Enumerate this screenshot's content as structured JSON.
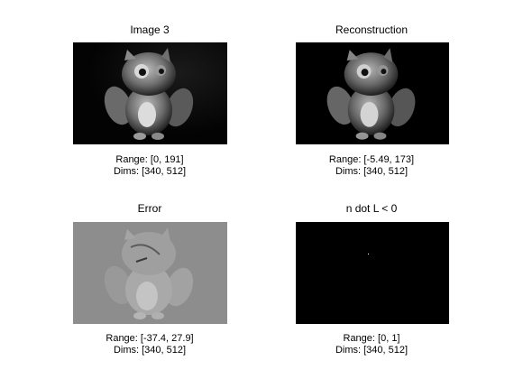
{
  "panels": [
    {
      "title": "Image 3",
      "range": "Range: [0, 191]",
      "dims": "Dims: [340, 512]"
    },
    {
      "title": "Reconstruction",
      "range": "Range: [-5.49, 173]",
      "dims": "Dims: [340, 512]"
    },
    {
      "title": "Error",
      "range": "Range: [-37.4, 27.9]",
      "dims": "Dims: [340, 512]"
    },
    {
      "title": "n dot L < 0",
      "range": "Range: [0, 1]",
      "dims": "Dims: [340, 512]"
    }
  ]
}
